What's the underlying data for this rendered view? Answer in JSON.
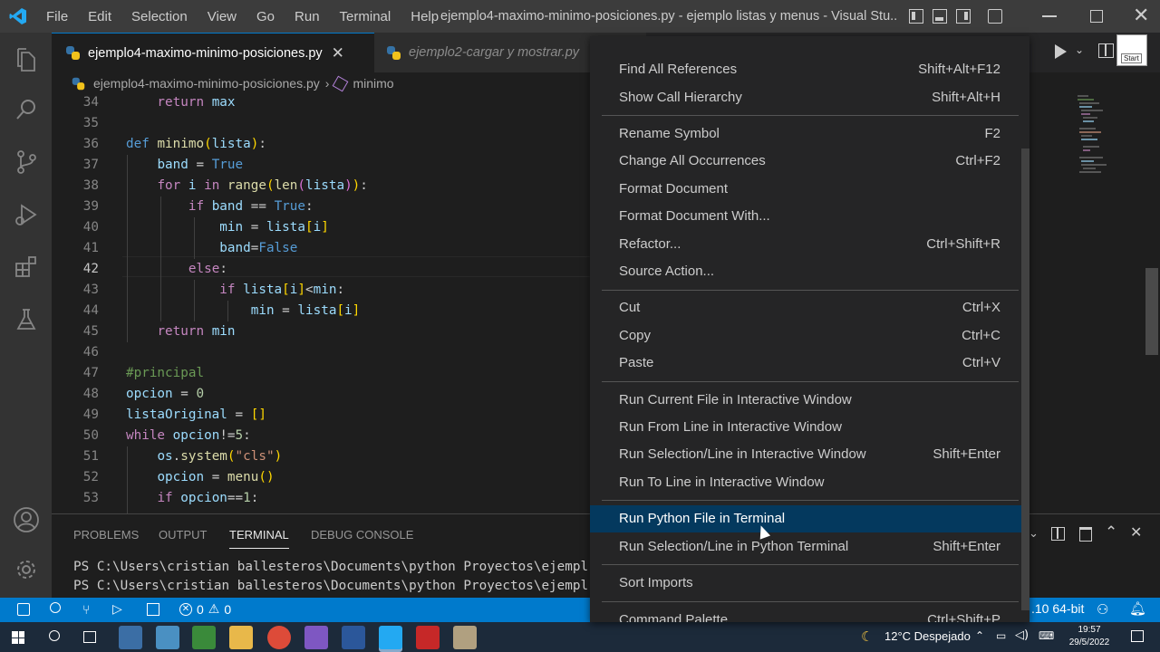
{
  "titlebar": {
    "menu": [
      "File",
      "Edit",
      "Selection",
      "View",
      "Go",
      "Run",
      "Terminal",
      "Help"
    ],
    "window_title": "ejemplo4-maximo-minimo-posiciones.py - ejemplo listas y menus - Visual Stu..."
  },
  "tabs": [
    {
      "label": "ejemplo4-maximo-minimo-posiciones.py",
      "active": true
    },
    {
      "label": "ejemplo2-cargar y mostrar.py",
      "active": false
    }
  ],
  "breadcrumb": {
    "file": "ejemplo4-maximo-minimo-posiciones.py",
    "symbol": "minimo"
  },
  "editor": {
    "lines": [
      {
        "n": "34",
        "code": "    return max"
      },
      {
        "n": "35",
        "code": ""
      },
      {
        "n": "36",
        "code": "def minimo(lista):"
      },
      {
        "n": "37",
        "code": "    band = True"
      },
      {
        "n": "38",
        "code": "    for i in range(len(lista)):"
      },
      {
        "n": "39",
        "code": "        if band == True:"
      },
      {
        "n": "40",
        "code": "            min = lista[i]"
      },
      {
        "n": "41",
        "code": "            band=False"
      },
      {
        "n": "42",
        "code": "        else:"
      },
      {
        "n": "43",
        "code": "            if lista[i]<min:"
      },
      {
        "n": "44",
        "code": "                min = lista[i]"
      },
      {
        "n": "45",
        "code": "    return min"
      },
      {
        "n": "46",
        "code": ""
      },
      {
        "n": "47",
        "code": "#principal"
      },
      {
        "n": "48",
        "code": "opcion = 0"
      },
      {
        "n": "49",
        "code": "listaOriginal = []"
      },
      {
        "n": "50",
        "code": "while opcion!=5:"
      },
      {
        "n": "51",
        "code": "    os.system(\"cls\")"
      },
      {
        "n": "52",
        "code": "    opcion = menu()"
      },
      {
        "n": "53",
        "code": "    if opcion==1:"
      }
    ],
    "current_line": "42"
  },
  "panel": {
    "tabs": [
      "PROBLEMS",
      "OUTPUT",
      "TERMINAL",
      "DEBUG CONSOLE"
    ],
    "active_tab": "TERMINAL",
    "terminal_lines": [
      "PS C:\\Users\\cristian ballesteros\\Documents\\python Proyectos\\ejempl",
      "PS C:\\Users\\cristian ballesteros\\Documents\\python Proyectos\\ejempl"
    ]
  },
  "context_menu": {
    "items": [
      {
        "label": "Find All References",
        "key": "Shift+Alt+F12"
      },
      {
        "label": "Show Call Hierarchy",
        "key": "Shift+Alt+H"
      },
      {
        "label": "Rename Symbol",
        "key": "F2"
      },
      {
        "label": "Change All Occurrences",
        "key": "Ctrl+F2"
      },
      {
        "label": "Format Document",
        "key": ""
      },
      {
        "label": "Format Document With...",
        "key": ""
      },
      {
        "label": "Refactor...",
        "key": "Ctrl+Shift+R"
      },
      {
        "label": "Source Action...",
        "key": ""
      },
      {
        "label": "Cut",
        "key": "Ctrl+X"
      },
      {
        "label": "Copy",
        "key": "Ctrl+C"
      },
      {
        "label": "Paste",
        "key": "Ctrl+V"
      },
      {
        "label": "Run Current File in Interactive Window",
        "key": ""
      },
      {
        "label": "Run From Line in Interactive Window",
        "key": ""
      },
      {
        "label": "Run Selection/Line in Interactive Window",
        "key": "Shift+Enter"
      },
      {
        "label": "Run To Line in Interactive Window",
        "key": ""
      },
      {
        "label": "Run Python File in Terminal",
        "key": "",
        "selected": true
      },
      {
        "label": "Run Selection/Line in Python Terminal",
        "key": "Shift+Enter"
      },
      {
        "label": "Sort Imports",
        "key": ""
      },
      {
        "label": "Command Palette...",
        "key": "Ctrl+Shift+P"
      }
    ]
  },
  "statusbar": {
    "errors": "0",
    "warnings": "0",
    "interpreter": ".10 64-bit"
  },
  "taskbar": {
    "weather": "12°C Despejado",
    "time": "19:57",
    "date": "29/5/2022"
  },
  "top_right": {
    "start_label": "Start"
  },
  "colors": {
    "accent": "#007acc",
    "menu_selected": "#04395e",
    "statusbar": "#007acc"
  }
}
